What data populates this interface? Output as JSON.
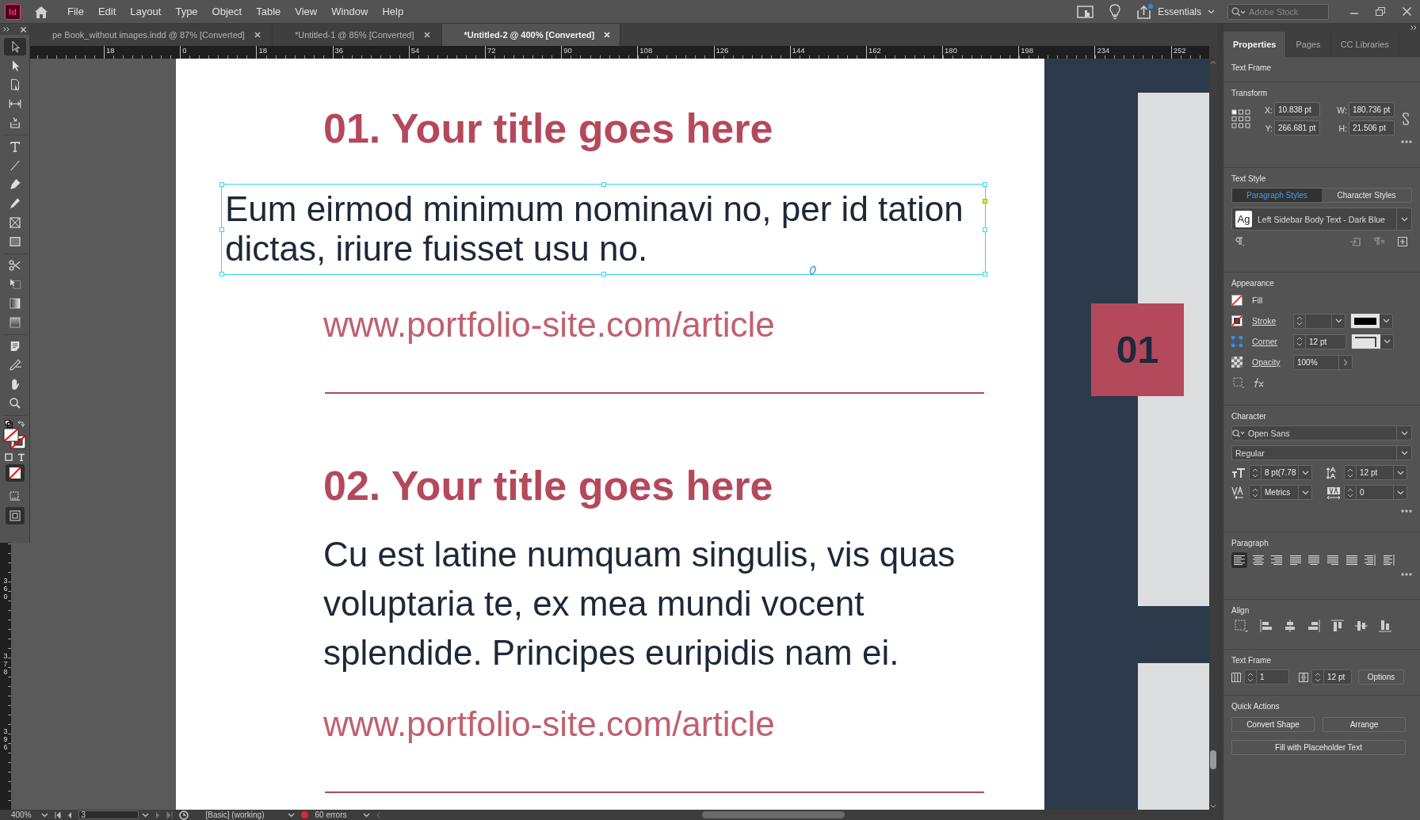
{
  "app": {
    "logo": "Id",
    "menu": [
      "File",
      "Edit",
      "Layout",
      "Type",
      "Object",
      "Table",
      "View",
      "Window",
      "Help"
    ],
    "workspace": "Essentials",
    "search": {
      "placeholder": "Adobe Stock"
    }
  },
  "doc_tabs": [
    {
      "label": "pe Book_without images.indd @ 87% [Converted]",
      "selected": false
    },
    {
      "label": "*Untitled-1 @ 85% [Converted]",
      "selected": false
    },
    {
      "label": "*Untitled-2 @ 400% [Converted]",
      "selected": true
    }
  ],
  "ruler": {
    "horizontal": [
      "18",
      "0",
      "18",
      "36",
      "54",
      "72",
      "90",
      "108",
      "126",
      "144",
      "162",
      "180",
      "198",
      "234",
      "252"
    ],
    "vertical": [
      "360",
      "378",
      "396"
    ]
  },
  "tools": [
    {
      "selected": true
    },
    {
      "selected": false
    },
    {
      "selected": false
    },
    {
      "selected": false
    },
    {
      "selected": false
    },
    {
      "selected": false
    },
    {
      "selected": false
    },
    {
      "selected": false
    },
    {
      "selected": false
    },
    {
      "selected": false
    },
    {
      "selected": false
    },
    {
      "selected": false
    },
    {
      "selected": false
    },
    {
      "selected": false
    },
    {
      "selected": false
    },
    {
      "selected": false
    },
    {
      "selected": false
    },
    {
      "selected": false
    },
    {
      "selected": false
    }
  ],
  "document": {
    "articles": [
      {
        "title": "01. Your title goes here",
        "body": [
          "Eum eirmod minimum nominavi no, per id tation",
          "dictas, iriure fuisset usu no."
        ],
        "selected": true,
        "url": "www.portfolio-site.com/article"
      },
      {
        "title": "02. Your title goes here",
        "body": [
          "Cu est latine numquam singulis, vis quas",
          "voluptaria te, ex mea mundi vocent",
          "splendide. Principes euripidis nam ei."
        ],
        "selected": false,
        "url": "www.portfolio-site.com/article"
      }
    ],
    "sidebar_number": "01"
  },
  "properties": {
    "tabs": [
      {
        "label": "Properties",
        "selected": true
      },
      {
        "label": "Pages",
        "selected": false
      },
      {
        "label": "CC Libraries",
        "selected": false
      }
    ],
    "object_type": "Text Frame",
    "transform": {
      "title": "Transform",
      "fields": [
        {
          "label": "X:",
          "value": "10.838 pt"
        },
        {
          "label": "W:",
          "value": "180.736 pt"
        },
        {
          "label": "Y:",
          "value": "266.681 pt"
        },
        {
          "label": "H:",
          "value": "21.506 pt"
        }
      ]
    },
    "text_style": {
      "title": "Text Style",
      "tabs": [
        {
          "label": "Paragraph Styles",
          "selected": true
        },
        {
          "label": "Character Styles",
          "selected": false
        }
      ],
      "preview": "Ag",
      "style": "Left Sidebar Body Text - Dark Blue"
    },
    "appearance": {
      "title": "Appearance",
      "fill": "Fill",
      "stroke": "Stroke",
      "corner": {
        "label": "Corner",
        "value": "12 pt"
      },
      "opacity": {
        "label": "Opacity",
        "value": "100%"
      }
    },
    "character": {
      "title": "Character",
      "font": "Open Sans",
      "style": "Regular",
      "size": "8 pt(7.78",
      "leading": "12 pt",
      "kerning": "Metrics",
      "tracking": "0"
    },
    "paragraph": {
      "title": "Paragraph",
      "alignments": [
        {
          "selected": true
        },
        {
          "selected": false
        },
        {
          "selected": false
        },
        {
          "selected": false
        },
        {
          "selected": false
        },
        {
          "selected": false
        },
        {
          "selected": false
        },
        {
          "selected": false
        },
        {
          "selected": false
        }
      ]
    },
    "align": {
      "title": "Align"
    },
    "text_frame": {
      "title": "Text Frame",
      "columns": "1",
      "gutter": "12 pt",
      "options_button": "Options"
    },
    "quick_actions": {
      "title": "Quick Actions",
      "buttons": [
        "Convert Shape",
        "Arrange",
        "Fill with Placeholder Text"
      ]
    }
  },
  "status_bar": {
    "zoom": "400%",
    "page": "3",
    "style": "[Basic] (working)",
    "errors": "60 errors"
  }
}
